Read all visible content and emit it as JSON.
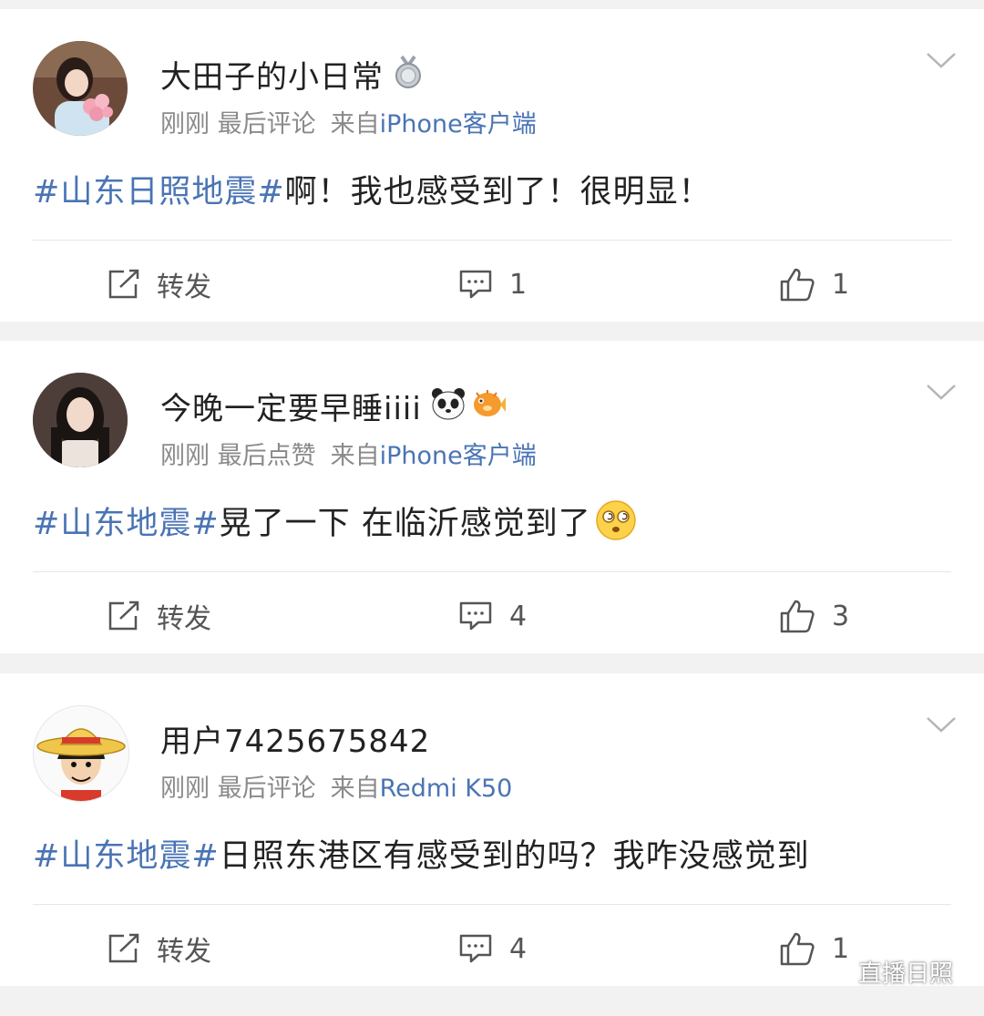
{
  "posts": [
    {
      "username": "大田子的小日常",
      "badge": "medal-icon",
      "time": "刚刚",
      "action": "最后评论",
      "from_prefix": "来自",
      "source": "iPhone客户端",
      "hashtag": "#山东日照地震#",
      "text": "啊！我也感受到了！很明显！",
      "repost_label": "转发",
      "comments": "1",
      "likes": "1"
    },
    {
      "username": "今晚一定要早睡iiii",
      "badge": "panda-emoji, pufferfish-emoji",
      "time": "刚刚",
      "action": "最后点赞",
      "from_prefix": "来自",
      "source": "iPhone客户端",
      "hashtag": "#山东地震#",
      "text": "晃了一下 在临沂感觉到了",
      "emoji": "dizzy-face-emoji",
      "repost_label": "转发",
      "comments": "4",
      "likes": "3"
    },
    {
      "username": "用户7425675842",
      "time": "刚刚",
      "action": "最后评论",
      "from_prefix": "来自",
      "source": "Redmi K50",
      "hashtag": "#山东地震#",
      "text": "日照东港区有感受到的吗？我咋没感觉到",
      "repost_label": "转发",
      "comments": "4",
      "likes": "1"
    }
  ],
  "watermark": {
    "text": "直播日照",
    "icon": "wechat-icon"
  },
  "colors": {
    "link": "#4a74b4",
    "text": "#222222",
    "meta": "#8a8a8a",
    "background": "#f2f2f2"
  }
}
